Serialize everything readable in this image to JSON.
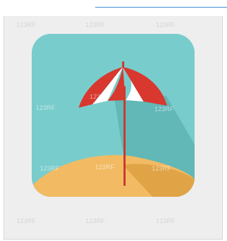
{
  "watermark": {
    "text": "123RF"
  },
  "icon": {
    "name": "beach-umbrella-icon",
    "colors": {
      "sky": "#79cccc",
      "sand": "#f2bb63",
      "sand_shadow": "#e0a447",
      "sky_shadow": "#62b7b7",
      "umbrella_red": "#d8382e",
      "umbrella_white": "#ffffff",
      "pole": "#c83a2e"
    }
  }
}
